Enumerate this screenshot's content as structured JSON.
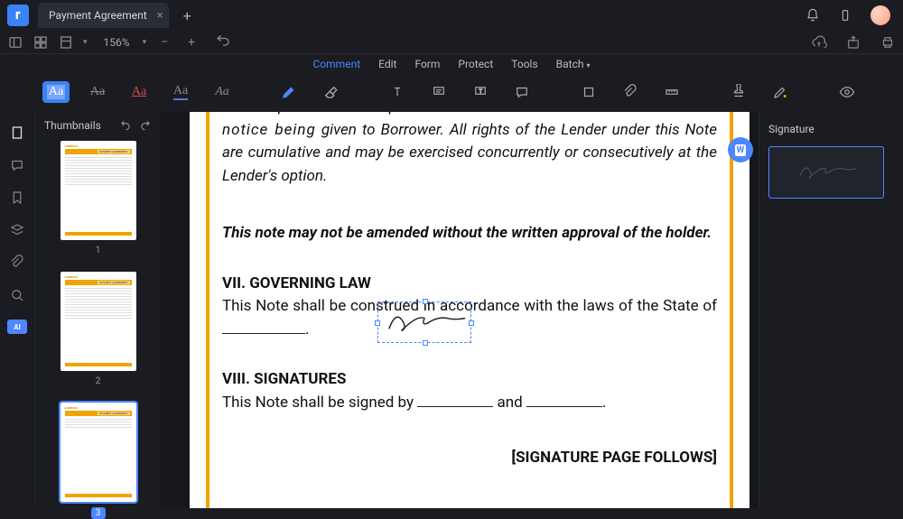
{
  "titlebar": {
    "document_name": "Payment Agreement"
  },
  "toolbar_top": {
    "zoom": "156%"
  },
  "menu": {
    "comment": "Comment",
    "edit": "Edit",
    "form": "Form",
    "protect": "Protect",
    "tools": "Tools",
    "batch": "Batch"
  },
  "thumbnails": {
    "title": "Thumbnails",
    "p1": "1",
    "p2": "2",
    "p3": "3"
  },
  "document": {
    "para1_partial": "given to Borrower. All rights of the Lender under this Note are cumulative and may be exercised concurrently or consecutively at the Lender's option.",
    "amend_note": "This note may not be amended without the written approval of the holder.",
    "sec7_title": "VII. GOVERNING LAW",
    "sec7_body_1": "This Note shall be construed in accordance with the laws of the State of ",
    "sec8_title": "VIII. SIGNATURES",
    "sec8_body_pre": "This Note shall be signed by ",
    "sec8_and": " and ",
    "sig_follows": "[SIGNATURE PAGE FOLLOWS]"
  },
  "right_panel": {
    "title": "Signature"
  },
  "ai": {
    "label": "AI"
  }
}
